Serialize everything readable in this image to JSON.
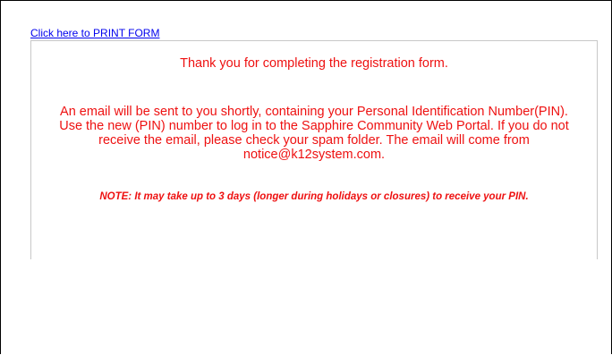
{
  "print_link": {
    "label": "Click here to PRINT FORM"
  },
  "confirmation": {
    "thanks_text": "Thank you for completing the registration form.",
    "email_message": "An email will be sent to you shortly, containing your Personal Identification Number(PIN). Use the new (PIN) number to log in to the Sapphire Community Web Portal. If you do not receive the email, please check your spam folder.  The email will come from notice@k12system.com.",
    "note": "NOTE:  It may take up to 3 days (longer during holidays or closures) to receive your PIN."
  },
  "colors": {
    "message_text": "#ee1111",
    "link": "#0000ee",
    "panel_border": "#c8c8c8"
  }
}
